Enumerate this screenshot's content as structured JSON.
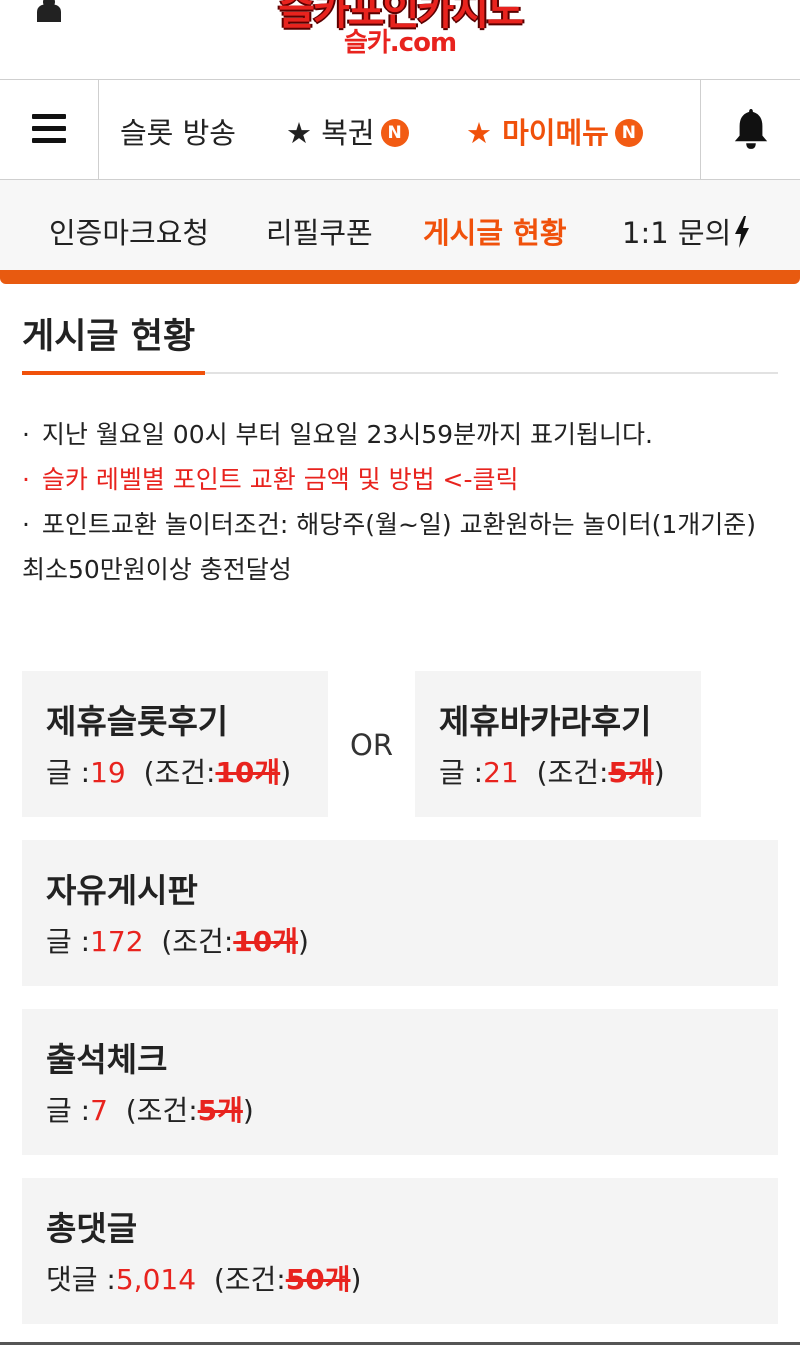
{
  "header": {
    "logo_text": "슬카포인카지노",
    "logo_sub": "슬카.com"
  },
  "main_nav": {
    "items": [
      {
        "label": "슬롯 방송"
      },
      {
        "label": "★ 복권",
        "badge": "N"
      },
      {
        "label": "★ 마이메뉴",
        "badge": "N"
      }
    ],
    "icons": [
      "menu-icon",
      "bell-icon",
      "user-icon"
    ]
  },
  "sub_nav": {
    "items": [
      {
        "label": "인증마크요청"
      },
      {
        "label": "리필쿠폰"
      },
      {
        "label": "게시글 현황"
      },
      {
        "label": "1:1 문의"
      }
    ],
    "active_index": 2,
    "accent_color": "#f0510b"
  },
  "page": {
    "title": "게시글 현황"
  },
  "notices": [
    {
      "bullet": "·",
      "text": "지난 월요일 00시 부터 일요일 23시59분까지 표기됩니다."
    },
    {
      "bullet": "·",
      "text": "슬카 레벨별 포인트 교환 금액 및 방법 <-클릭"
    },
    {
      "bullet": "·",
      "text": "포인트교환 놀이터조건: 해당주(월~일) 교환원하는 놀이터(1개기준) 최소50만원이상 충전달성"
    }
  ],
  "or_label": "OR",
  "stats": [
    {
      "title": "제휴슬롯후기",
      "count_label": "글 :",
      "count": "19",
      "cond_open": "(조건:",
      "cond_value": "10개",
      "cond_close": ")"
    },
    {
      "title": "제휴바카라후기",
      "count_label": "글 :",
      "count": "21",
      "cond_open": "(조건:",
      "cond_value": "5개",
      "cond_close": ")"
    },
    {
      "title": "자유게시판",
      "count_label": "글 :",
      "count": "172",
      "cond_open": "(조건:",
      "cond_value": "10개",
      "cond_close": ")"
    },
    {
      "title": "출석체크",
      "count_label": "글 :",
      "count": "7",
      "cond_open": "(조건:",
      "cond_value": "5개",
      "cond_close": ")"
    },
    {
      "title": "총댓글",
      "count_label": "댓글 :",
      "count": "5,014",
      "cond_open": "(조건:",
      "cond_value": "50개",
      "cond_close": ")"
    }
  ],
  "colors": {
    "accent": "#f0510b",
    "count_red": "#e8231e",
    "card_bg": "#f4f4f4"
  }
}
